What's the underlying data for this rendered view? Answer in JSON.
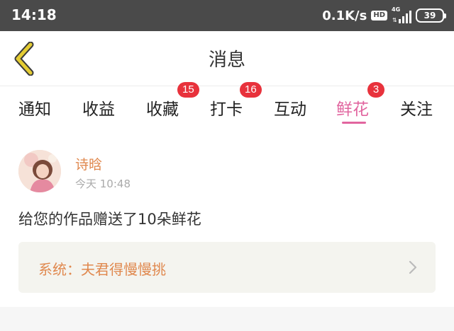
{
  "status_bar": {
    "time": "14:18",
    "net_speed": "0.1K/s",
    "hd": "HD",
    "network": "4G",
    "battery": "39"
  },
  "header": {
    "title": "消息",
    "back_icon": "chevron-left-icon",
    "back_color": "#e4cc33"
  },
  "tabs": [
    {
      "label": "通知",
      "badge": ""
    },
    {
      "label": "收益",
      "badge": ""
    },
    {
      "label": "收藏",
      "badge": "15"
    },
    {
      "label": "打卡",
      "badge": "16"
    },
    {
      "label": "互动",
      "badge": ""
    },
    {
      "label": "鲜花",
      "badge": "3",
      "active": true
    },
    {
      "label": "关注",
      "badge": ""
    }
  ],
  "message": {
    "sender": "诗晗",
    "time": "今天 10:48",
    "text": "给您的作品赠送了10朵鲜花",
    "system_text": "系统：夫君得慢慢挑"
  },
  "colors": {
    "accent": "#e1659f",
    "badge": "#e8323c",
    "name": "#e0884e",
    "status_bar": "#4a4a4a"
  }
}
